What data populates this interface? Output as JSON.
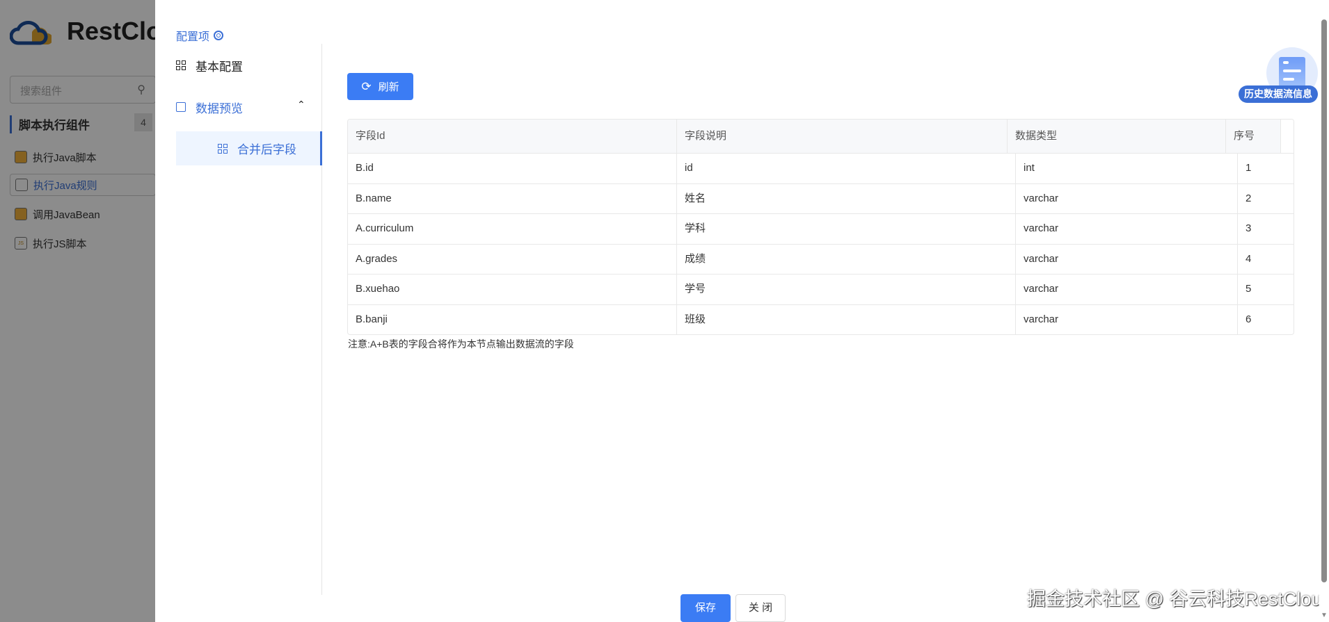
{
  "background": {
    "logo_text": "RestClo",
    "search_placeholder": "搜索组件",
    "group": {
      "title": "脚本执行组件",
      "count": "4"
    },
    "components": [
      {
        "label": "执行Java脚本",
        "icon": "java-file-icon",
        "selected": false
      },
      {
        "label": "执行Java规则",
        "icon": "java-rule-icon",
        "selected": true
      },
      {
        "label": "调用JavaBean",
        "icon": "javabean-icon",
        "selected": false
      },
      {
        "label": "执行JS脚本",
        "icon": "js-file-icon",
        "selected": false
      }
    ]
  },
  "drawer": {
    "config_title": "配置项",
    "menu": [
      {
        "label": "基本配置",
        "icon": "grid-icon"
      },
      {
        "label": "数据预览",
        "icon": "data-preview-icon",
        "expanded": true
      },
      {
        "label": "合并后字段",
        "icon": "grid-icon",
        "active": true
      }
    ],
    "refresh_label": "刷新",
    "table": {
      "headers": [
        "字段Id",
        "字段说明",
        "数据类型",
        "序号"
      ],
      "rows": [
        [
          "B.id",
          "id",
          "int",
          "1"
        ],
        [
          "B.name",
          "姓名",
          "varchar",
          "2"
        ],
        [
          "A.curriculum",
          "学科",
          "varchar",
          "3"
        ],
        [
          "A.grades",
          "成绩",
          "varchar",
          "4"
        ],
        [
          "B.xuehao",
          "学号",
          "varchar",
          "5"
        ],
        [
          "B.banji",
          "班级",
          "varchar",
          "6"
        ]
      ]
    },
    "note": "注意:A+B表的字段合将作为本节点输出数据流的字段",
    "history_label": "历史数据流信息",
    "save_label": "保存",
    "close_label": "关 闭"
  },
  "watermark": "掘金技术社区 @ 谷云科技RestCloud",
  "colors": {
    "primary": "#3b7cf4",
    "accent": "#3b6fd6"
  }
}
